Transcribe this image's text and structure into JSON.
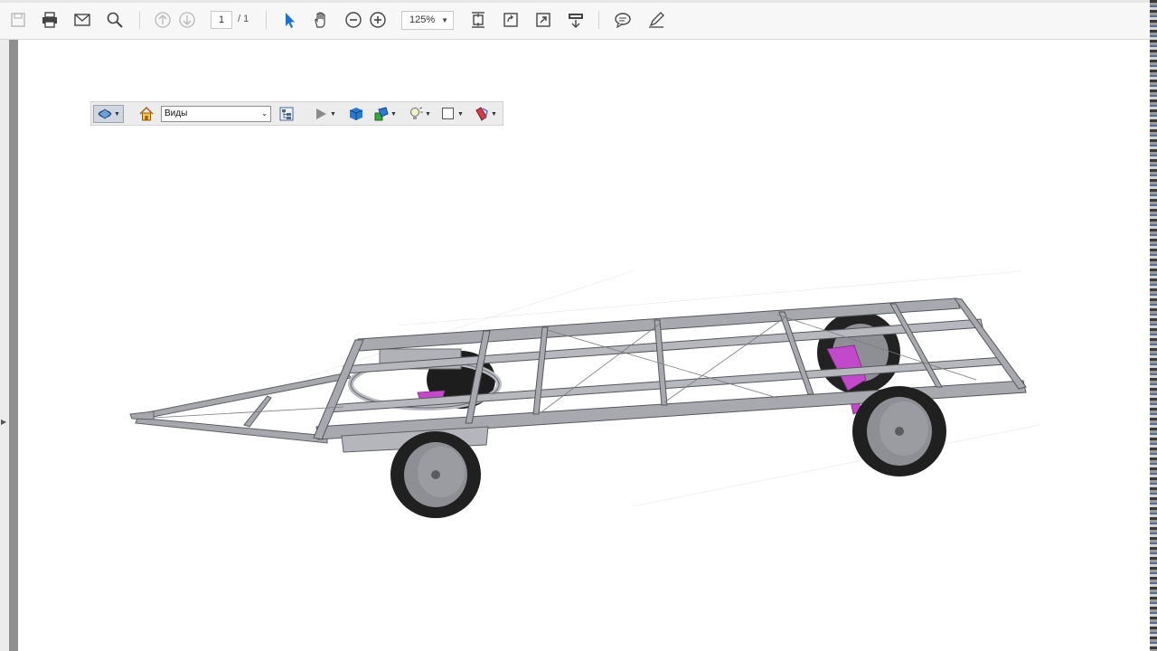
{
  "toolbar": {
    "page_current": "1",
    "page_total": "/ 1",
    "zoom": "125%",
    "icons": [
      "save-icon",
      "print-icon",
      "email-icon",
      "search-icon",
      "page-up-icon",
      "page-down-icon",
      "select-arrow-icon",
      "hand-icon",
      "zoom-out-icon",
      "zoom-in-icon",
      "fit-page-icon",
      "rotate-icon",
      "fullscreen-icon",
      "scroll-mode-icon",
      "comment-icon",
      "sign-pen-icon"
    ]
  },
  "toolbar_3d": {
    "views_label": "Виды",
    "icons": [
      "rotate-3d-icon",
      "home-icon",
      "model-tree-icon",
      "play-icon",
      "projection-cube-icon",
      "render-mode-icon",
      "lighting-icon",
      "background-color-icon",
      "cross-section-icon"
    ]
  },
  "canvas": {
    "subject": "trailer-chassis-3d-model",
    "frame_color": "#a7a9ae",
    "wheel_color": "#222222",
    "hub_color": "#8d8f94",
    "accent_color": "#c249c9"
  }
}
